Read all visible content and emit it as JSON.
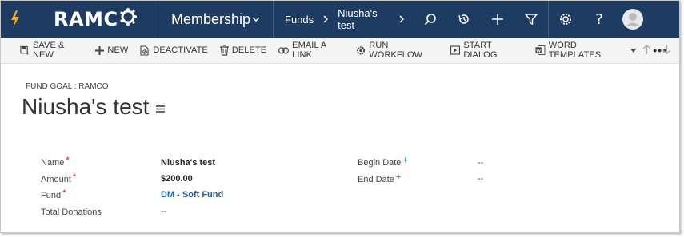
{
  "nav": {
    "brand": "RAMCO",
    "module": "Membership",
    "breadcrumb": [
      "Funds",
      "Niusha's test"
    ]
  },
  "commands": [
    {
      "label": "SAVE & NEW",
      "icon": "save-new-icon"
    },
    {
      "label": "NEW",
      "icon": "plus-icon"
    },
    {
      "label": "DEACTIVATE",
      "icon": "deactivate-icon"
    },
    {
      "label": "DELETE",
      "icon": "trash-icon"
    },
    {
      "label": "EMAIL A LINK",
      "icon": "link-icon"
    },
    {
      "label": "RUN WORKFLOW",
      "icon": "workflow-icon"
    },
    {
      "label": "START DIALOG",
      "icon": "dialog-icon"
    },
    {
      "label": "WORD TEMPLATES",
      "icon": "word-icon"
    }
  ],
  "header": {
    "entity_label": "FUND GOAL : RAMCO",
    "title": "Niusha's test"
  },
  "form": {
    "left": [
      {
        "label": "Name",
        "marker": "*",
        "value": "Niusha's test"
      },
      {
        "label": "Amount",
        "marker": "*",
        "value": "$200.00"
      },
      {
        "label": "Fund",
        "marker": "*",
        "value": "DM - Soft Fund"
      },
      {
        "label": "Total Donations",
        "marker": "",
        "value": "--"
      }
    ],
    "right": [
      {
        "label": "Begin Date",
        "marker": "+",
        "value": "--"
      },
      {
        "label": "End Date",
        "marker": "+",
        "value": "--"
      }
    ]
  },
  "colors": {
    "nav_bg": "#1e3b62",
    "accent_orange": "#f5a623",
    "required": "#e00000",
    "recommended": "#1b62c4",
    "link": "#1e5fa8"
  }
}
